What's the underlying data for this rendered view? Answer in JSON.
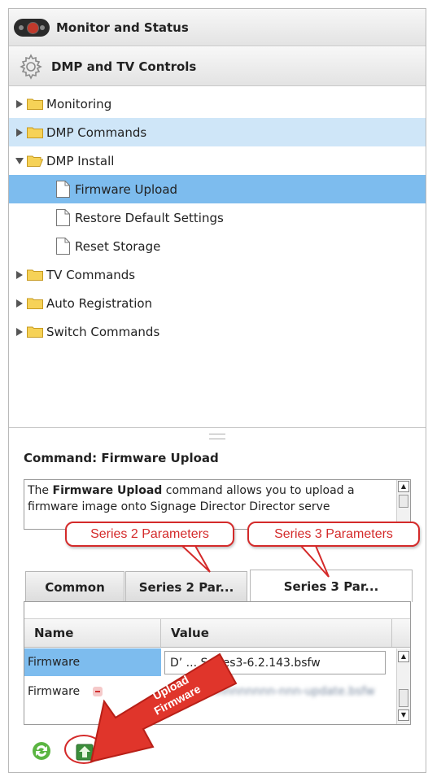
{
  "accordion": {
    "monitor_title": "Monitor and Status",
    "dmp_title": "DMP and TV Controls"
  },
  "tree": [
    {
      "label": "Monitoring",
      "type": "folder",
      "expanded": false,
      "level": 0
    },
    {
      "label": "DMP Commands",
      "type": "folder",
      "expanded": false,
      "level": 0
    },
    {
      "label": "DMP Install",
      "type": "folder",
      "expanded": true,
      "level": 0
    },
    {
      "label": "Firmware Upload",
      "type": "file",
      "level": 1,
      "selected": true
    },
    {
      "label": "Restore Default Settings",
      "type": "file",
      "level": 1
    },
    {
      "label": "Reset Storage",
      "type": "file",
      "level": 1
    },
    {
      "label": "TV Commands",
      "type": "folder",
      "expanded": false,
      "level": 0
    },
    {
      "label": "Auto Registration",
      "type": "folder",
      "expanded": false,
      "level": 0
    },
    {
      "label": "Switch Commands",
      "type": "folder",
      "expanded": false,
      "level": 0
    }
  ],
  "command": {
    "title": "Command: Firmware Upload",
    "desc_prefix": "The ",
    "desc_bold": "Firmware Upload",
    "desc_suffix": " command allows you to upload a firmware image onto Signage Director Director serve"
  },
  "callouts": {
    "series2": "Series 2 Parameters",
    "series3": "Series 3 Parameters",
    "upload": "Upload Firmware"
  },
  "tabs": [
    "Common",
    "Series 2 Par...",
    "Series 3 Par..."
  ],
  "active_tab": 2,
  "grid": {
    "headers": [
      "Name",
      "Value"
    ],
    "rows": [
      {
        "name": "Firmware",
        "value": "DMP-Series3-6.2.143.bsfw",
        "value_shown": "D’ ... Series3-6.2.143.bsfw",
        "selected": true
      },
      {
        "name": "Firmware",
        "value_blurred": "nnnnnnnnn-nnn-update.bsfw"
      }
    ]
  },
  "colors": {
    "selection": "#7dbcee",
    "selection_light": "#cfe6f8",
    "annotation_red": "#d42a2a"
  }
}
